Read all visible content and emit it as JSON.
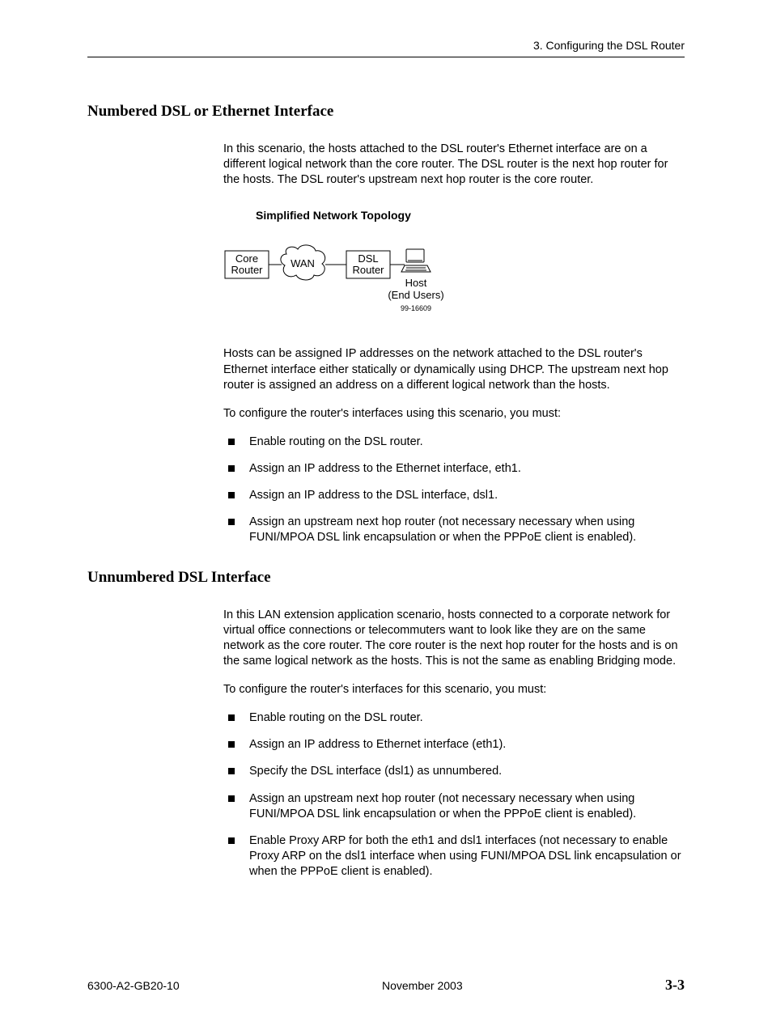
{
  "header": {
    "chapter": "3. Configuring the DSL Router"
  },
  "section1": {
    "heading": "Numbered DSL or Ethernet Interface",
    "para1": "In this scenario, the hosts attached to the DSL router's Ethernet interface are on a different logical network than the core router. The DSL router is the next hop router for the hosts. The DSL router's upstream next hop router is the core router.",
    "diagram_title": "Simplified Network Topology",
    "diagram": {
      "core": "Core\nRouter",
      "wan": "WAN",
      "dsl": "DSL\nRouter",
      "host_label": "Host\n(End Users)",
      "ref": "99-16609"
    },
    "para2": "Hosts can be assigned IP addresses on the network attached to the DSL router's Ethernet interface either statically or dynamically using DHCP. The upstream next hop router is assigned an address on a different logical network than the hosts.",
    "para3": "To configure the router's interfaces using this scenario, you must:",
    "bullets": [
      "Enable routing on the DSL router.",
      "Assign an IP address to the Ethernet interface, eth1.",
      "Assign an IP address to the DSL interface, dsl1.",
      "Assign an upstream next hop router (not necessary necessary when using FUNI/MPOA DSL link encapsulation or when the PPPoE client is enabled)."
    ]
  },
  "section2": {
    "heading": "Unnumbered DSL Interface",
    "para1": "In this LAN extension application scenario, hosts connected to a corporate network for virtual office connections or telecommuters want to look like they are on the same network as the core router. The core router is the next hop router for the hosts and is on the same logical network as the hosts. This is not the same as enabling Bridging mode.",
    "para2": "To configure the router's interfaces for this scenario, you must:",
    "bullets": [
      "Enable routing on the DSL router.",
      "Assign an IP address to Ethernet interface (eth1).",
      "Specify the DSL interface (dsl1) as unnumbered.",
      "Assign an upstream next hop router (not necessary necessary when using FUNI/MPOA DSL link encapsulation or when the PPPoE client is enabled).",
      "Enable Proxy ARP for both the eth1 and dsl1 interfaces (not necessary to enable Proxy ARP on the dsl1 interface when using FUNI/MPOA DSL link encapsulation or when the PPPoE client is enabled)."
    ]
  },
  "footer": {
    "doc": "6300-A2-GB20-10",
    "date": "November 2003",
    "page": "3-3"
  }
}
